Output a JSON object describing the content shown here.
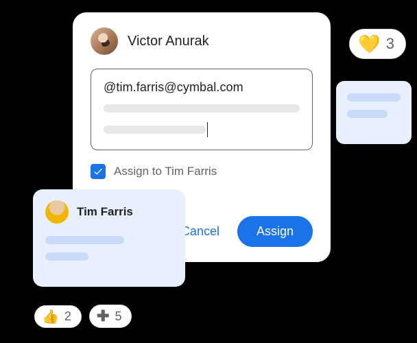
{
  "dialog": {
    "author_name": "Victor Anurak",
    "comment_text": "@tim.farris@cymbal.com",
    "assign_label": "Assign to Tim Farris",
    "assign_checked": true,
    "cancel_label": "Cancel",
    "assign_button_label": "Assign"
  },
  "reply": {
    "author_name": "Tim Farris"
  },
  "reactions": {
    "heart": {
      "emoji": "💛",
      "count": "3"
    },
    "thumb": {
      "emoji": "👍",
      "count": "2"
    },
    "plus": {
      "glyph": "✚",
      "count": "5"
    }
  }
}
